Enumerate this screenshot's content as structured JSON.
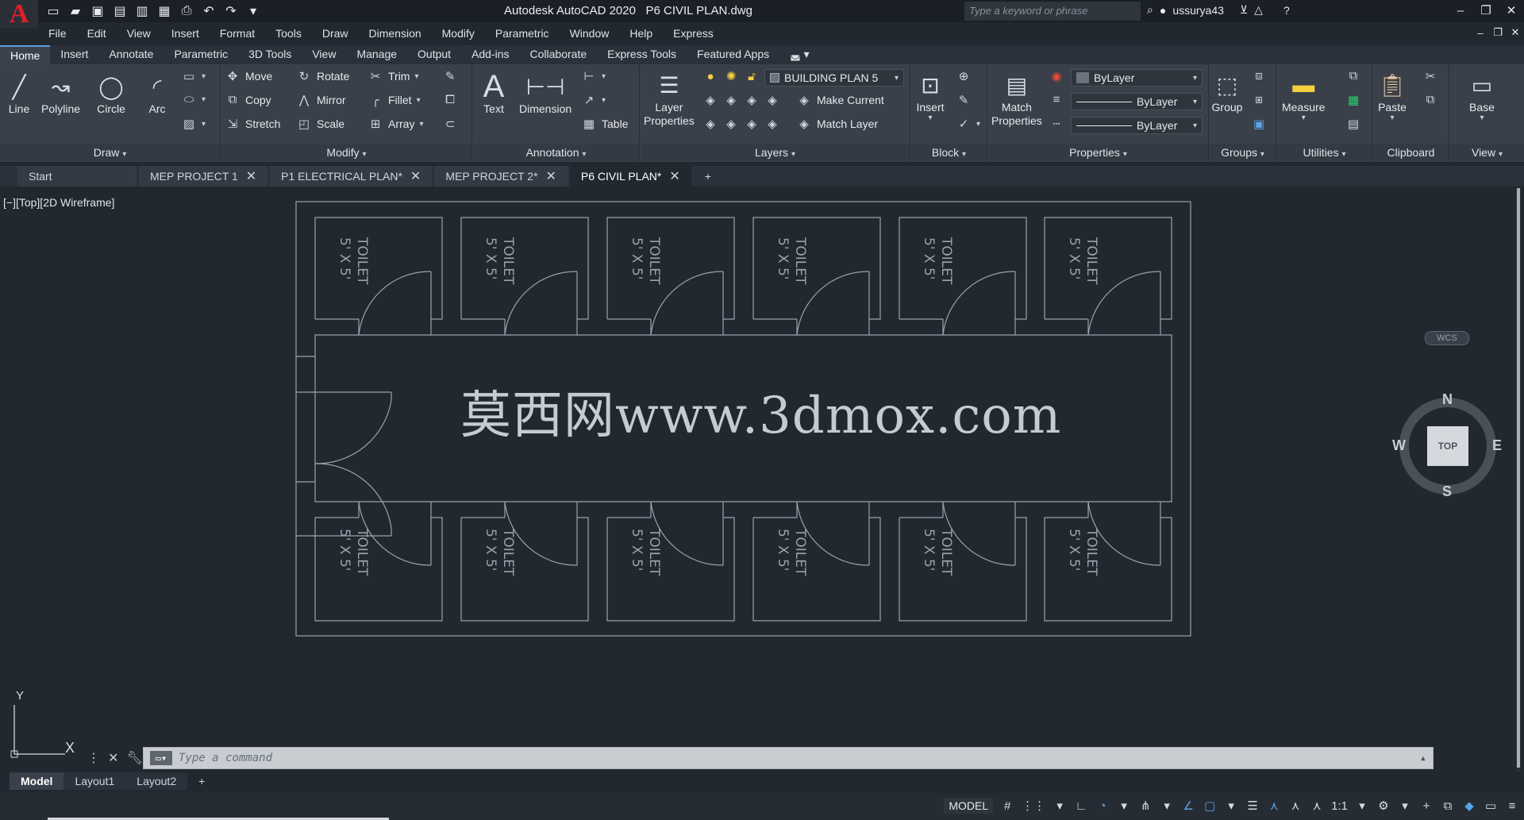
{
  "title_bar": {
    "app_version": "Autodesk AutoCAD 2020",
    "file_name": "P6 CIVIL PLAN.dwg",
    "search_placeholder": "Type a keyword or phrase",
    "username": "ussurya43"
  },
  "menu": [
    "File",
    "Edit",
    "View",
    "Insert",
    "Format",
    "Tools",
    "Draw",
    "Dimension",
    "Modify",
    "Parametric",
    "Window",
    "Help",
    "Express"
  ],
  "ribbon_tabs": [
    "Home",
    "Insert",
    "Annotate",
    "Parametric",
    "3D Tools",
    "View",
    "Manage",
    "Output",
    "Add-ins",
    "Collaborate",
    "Express Tools",
    "Featured Apps"
  ],
  "ribbon": {
    "draw": {
      "title": "Draw",
      "line": "Line",
      "polyline": "Polyline",
      "circle": "Circle",
      "arc": "Arc"
    },
    "modify": {
      "title": "Modify",
      "move": "Move",
      "rotate": "Rotate",
      "trim": "Trim",
      "copy": "Copy",
      "mirror": "Mirror",
      "fillet": "Fillet",
      "stretch": "Stretch",
      "scale": "Scale",
      "array": "Array"
    },
    "annotation": {
      "title": "Annotation",
      "text": "Text",
      "dimension": "Dimension",
      "table": "Table"
    },
    "layers": {
      "title": "Layers",
      "layer_properties_1": "Layer",
      "layer_properties_2": "Properties",
      "current_layer": "BUILDING PLAN 5",
      "make_current": "Make Current",
      "match_layer": "Match Layer"
    },
    "block": {
      "title": "Block",
      "insert": "Insert"
    },
    "properties": {
      "title": "Properties",
      "match_1": "Match",
      "match_2": "Properties",
      "color": "ByLayer",
      "linetype": "ByLayer",
      "lineweight": "ByLayer"
    },
    "groups": {
      "title": "Groups",
      "group": "Group"
    },
    "utilities": {
      "title": "Utilities",
      "measure": "Measure"
    },
    "clipboard": {
      "title": "Clipboard",
      "paste": "Paste"
    },
    "view": {
      "title": "View",
      "base": "Base"
    }
  },
  "file_tabs": {
    "start": "Start",
    "tabs": [
      "MEP PROJECT 1",
      "P1 ELECTRICAL PLAN*",
      "MEP PROJECT 2*",
      "P6 CIVIL PLAN*"
    ]
  },
  "viewport": {
    "label": "[−][Top][2D Wireframe]",
    "watermark": "莫西网www.3dmox.com",
    "room_label_1": "TOILET",
    "room_label_2": "5' X 5'"
  },
  "viewcube": {
    "n": "N",
    "s": "S",
    "e": "E",
    "w": "W",
    "face": "TOP",
    "wcs": "WCS"
  },
  "ucs": {
    "y": "Y",
    "x": "X"
  },
  "command_line": {
    "placeholder": "Type a command"
  },
  "layout_tabs": [
    "Model",
    "Layout1",
    "Layout2"
  ],
  "status_bar": {
    "mode": "MODEL",
    "scale": "1:1"
  },
  "colors": {
    "background": "#212830",
    "ribbon": "#39404a",
    "accent": "#5aa3e6",
    "logo_red": "#e02028",
    "linework": "#9aa2ab"
  }
}
